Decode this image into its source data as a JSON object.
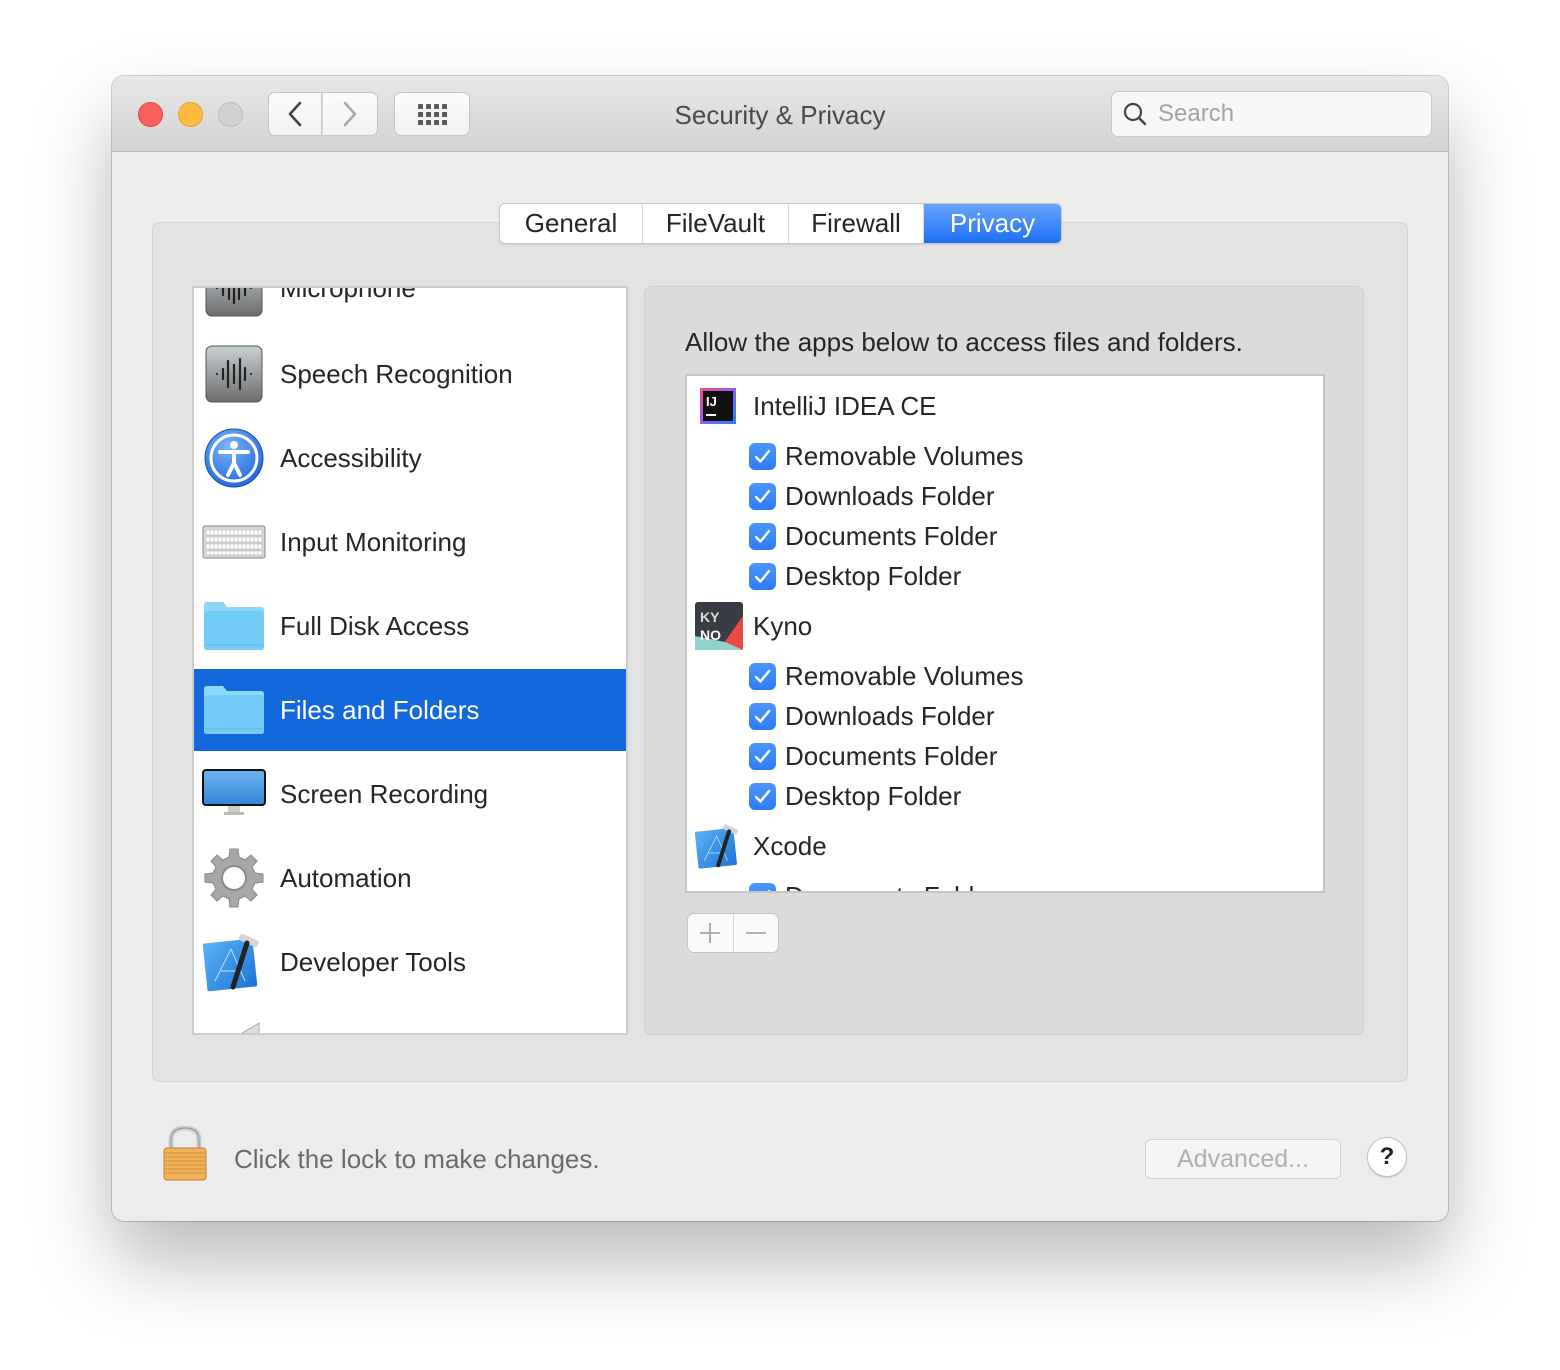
{
  "window": {
    "title": "Security & Privacy",
    "search_placeholder": "Search"
  },
  "toolbar": {
    "back_icon": "chevron-left-icon",
    "forward_icon": "chevron-right-icon",
    "show_all_icon": "grid-icon"
  },
  "tabs": [
    {
      "label": "General",
      "active": false
    },
    {
      "label": "FileVault",
      "active": false
    },
    {
      "label": "Firewall",
      "active": false
    },
    {
      "label": "Privacy",
      "active": true
    }
  ],
  "sidebar": {
    "items": [
      {
        "label": "Microphone",
        "icon": "microphone-waveform-icon",
        "selected": false
      },
      {
        "label": "Speech Recognition",
        "icon": "speech-waveform-icon",
        "selected": false
      },
      {
        "label": "Accessibility",
        "icon": "accessibility-icon",
        "selected": false
      },
      {
        "label": "Input Monitoring",
        "icon": "keyboard-icon",
        "selected": false
      },
      {
        "label": "Full Disk Access",
        "icon": "folder-icon",
        "selected": false
      },
      {
        "label": "Files and Folders",
        "icon": "folder-icon",
        "selected": true
      },
      {
        "label": "Screen Recording",
        "icon": "display-icon",
        "selected": false
      },
      {
        "label": "Automation",
        "icon": "gear-icon",
        "selected": false
      },
      {
        "label": "Developer Tools",
        "icon": "xcode-icon",
        "selected": false
      },
      {
        "label": "",
        "icon": "megaphone-icon",
        "selected": false
      }
    ]
  },
  "panel": {
    "description": "Allow the apps below to access files and folders.",
    "apps": [
      {
        "name": "IntelliJ IDEA CE",
        "icon": "intellij-icon",
        "permissions": [
          {
            "label": "Removable Volumes",
            "checked": true
          },
          {
            "label": "Downloads Folder",
            "checked": true
          },
          {
            "label": "Documents Folder",
            "checked": true
          },
          {
            "label": "Desktop Folder",
            "checked": true
          }
        ]
      },
      {
        "name": "Kyno",
        "icon": "kyno-icon",
        "permissions": [
          {
            "label": "Removable Volumes",
            "checked": true
          },
          {
            "label": "Downloads Folder",
            "checked": true
          },
          {
            "label": "Documents Folder",
            "checked": true
          },
          {
            "label": "Desktop Folder",
            "checked": true
          }
        ]
      },
      {
        "name": "Xcode",
        "icon": "xcode-icon",
        "permissions": [
          {
            "label": "Documents Folder",
            "checked": true
          }
        ]
      }
    ],
    "add_label": "+",
    "remove_label": "−"
  },
  "footer": {
    "lock_text": "Click the lock to make changes.",
    "advanced_label": "Advanced...",
    "help_label": "?"
  },
  "colors": {
    "accent": "#1369dc",
    "tab_active": "#1c6ff5",
    "checkbox": "#3a86f8",
    "close": "#fc605c",
    "minimize": "#fdbc40"
  }
}
